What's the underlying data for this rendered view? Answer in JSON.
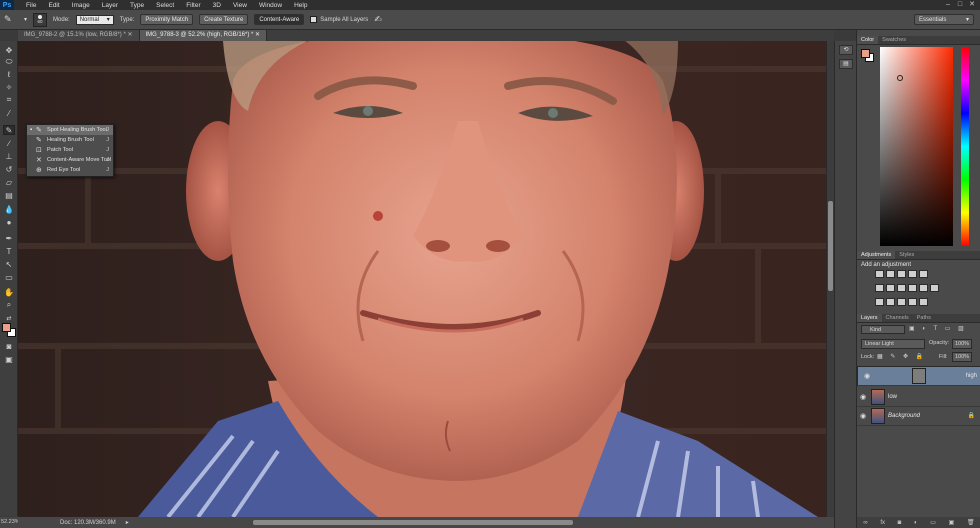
{
  "app": {
    "logo": "Ps"
  },
  "menu": [
    "File",
    "Edit",
    "Image",
    "Layer",
    "Type",
    "Select",
    "Filter",
    "3D",
    "View",
    "Window",
    "Help"
  ],
  "options": {
    "mode_label": "Mode:",
    "mode_value": "Normal",
    "type_label": "Type:",
    "type_buttons": [
      "Proximity Match",
      "Create Texture",
      "Content-Aware"
    ],
    "sample_all_layers": "Sample All Layers",
    "brush_size": "60",
    "workspace": "Essentials"
  },
  "tabs": [
    {
      "label": "IMG_9788-2 @ 15.1% (low, RGB/8*) *",
      "active": false
    },
    {
      "label": "IMG_9788-3 @ 52.2% (high, RGB/16*) *",
      "active": true
    }
  ],
  "flyout": [
    {
      "label": "Spot Healing Brush Tool",
      "key": "J",
      "active": true
    },
    {
      "label": "Healing Brush Tool",
      "key": "J",
      "active": false
    },
    {
      "label": "Patch Tool",
      "key": "J",
      "active": false
    },
    {
      "label": "Content-Aware Move Tool",
      "key": "J",
      "active": false
    },
    {
      "label": "Red Eye Tool",
      "key": "J",
      "active": false
    }
  ],
  "status": {
    "zoom": "52.23%",
    "doc": "Doc: 120.3M/360.9M"
  },
  "panels": {
    "color_tabs": [
      "Color",
      "Swatches"
    ],
    "adjust_tabs": [
      "Adjustments",
      "Styles"
    ],
    "adjust_title": "Add an adjustment",
    "layer_tabs": [
      "Layers",
      "Channels",
      "Paths"
    ],
    "kind": "Kind",
    "blend_mode": "Linear Light",
    "opacity_label": "Opacity:",
    "opacity_value": "100%",
    "lock_label": "Lock:",
    "fill_label": "Fill:",
    "fill_value": "100%",
    "layers": [
      {
        "name": "high",
        "selected": true,
        "italic": false
      },
      {
        "name": "low",
        "selected": false,
        "italic": false
      },
      {
        "name": "Background",
        "selected": false,
        "italic": true
      }
    ]
  },
  "colors": {
    "fg": "#e8a08c",
    "bg": "#ffffff",
    "accent": "#6a7f9a"
  }
}
